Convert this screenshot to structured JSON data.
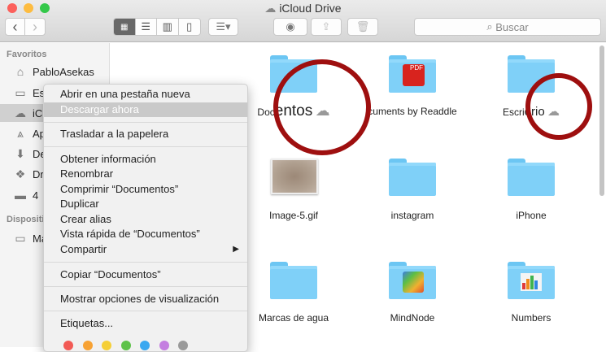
{
  "window": {
    "title": "iCloud Drive",
    "traffic_colors": [
      "#fc605b",
      "#fdbc40",
      "#34c84a"
    ]
  },
  "toolbar": {
    "back": "‹",
    "forward": "›",
    "search_placeholder": "Buscar",
    "search_icon": "magnifier-icon"
  },
  "sidebar": {
    "sections": [
      {
        "header": "Favoritos",
        "items": [
          {
            "label": "PabloAsekas",
            "icon": "home-icon"
          },
          {
            "label": "Es",
            "icon": "desktop-icon"
          },
          {
            "label": "iC",
            "icon": "cloud-icon",
            "selected": true
          },
          {
            "label": "Ap",
            "icon": "applications-icon"
          },
          {
            "label": "De",
            "icon": "download-icon"
          },
          {
            "label": "Dr",
            "icon": "dropbox-icon"
          },
          {
            "label": "4",
            "icon": "folder-icon"
          }
        ]
      },
      {
        "header": "Dispositi",
        "items": [
          {
            "label": "Ma",
            "icon": "laptop-icon"
          }
        ]
      }
    ]
  },
  "files": [
    {
      "name": "Documentos",
      "shown": "Doc",
      "zoomed": "entos",
      "cloud": true,
      "type": "folder"
    },
    {
      "name": "cuments by Readdle",
      "type": "folder-pdf"
    },
    {
      "name": "Escri",
      "zoomed": "orio",
      "cloud": true,
      "type": "folder"
    },
    {
      "name": "Image-5.gif",
      "type": "image"
    },
    {
      "name": "instagram",
      "type": "folder"
    },
    {
      "name": "iPhone",
      "type": "folder"
    },
    {
      "name": "Marcas de agua",
      "type": "folder"
    },
    {
      "name": "MindNode",
      "type": "folder-app"
    },
    {
      "name": "Numbers",
      "type": "folder-app"
    }
  ],
  "context_menu": {
    "items": [
      "Abrir en una pestaña nueva",
      "Descargar ahora",
      "Trasladar a la papelera",
      "Obtener información",
      "Renombrar",
      "Comprimir “Documentos”",
      "Duplicar",
      "Crear alias",
      "Vista rápida de “Documentos”",
      "Compartir",
      "Copiar “Documentos”",
      "Mostrar opciones de visualización",
      "Etiquetas..."
    ],
    "highlighted": "Descargar ahora",
    "submenu_arrow": "▶",
    "tag_colors": [
      "#f25a55",
      "#f7a234",
      "#f5cf36",
      "#5ec24a",
      "#3aa8f0",
      "#c47ee0",
      "#9a9a9a"
    ]
  },
  "annotation_color": "#9e0f0f"
}
